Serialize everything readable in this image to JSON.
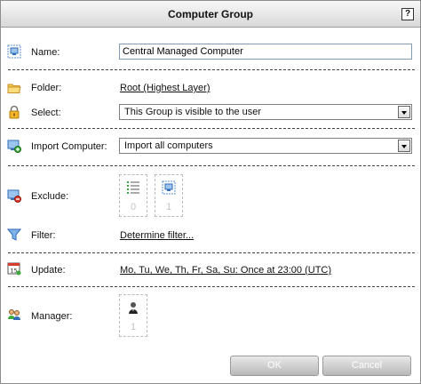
{
  "dialog": {
    "title": "Computer Group",
    "help": "?"
  },
  "fields": {
    "name": {
      "label": "Name:",
      "value": "Central Managed Computer"
    },
    "folder": {
      "label": "Folder:",
      "link": "Root (Highest Layer)"
    },
    "select": {
      "label": "Select:",
      "value": "This Group is visible to the user"
    },
    "import": {
      "label": "Import Computer:",
      "value": "Import all computers"
    },
    "exclude": {
      "label": "Exclude:",
      "tiles": [
        {
          "icon": "list-icon",
          "count": "0"
        },
        {
          "icon": "computer-icon",
          "count": "1"
        }
      ]
    },
    "filter": {
      "label": "Filter:",
      "link": "Determine filter..."
    },
    "update": {
      "label": "Update:",
      "link": "Mo, Tu, We, Th, Fr, Sa, Su: Once at 23:00 (UTC)"
    },
    "manager": {
      "label": "Manager:",
      "tiles": [
        {
          "icon": "user-icon",
          "count": "1"
        }
      ]
    }
  },
  "buttons": {
    "ok": "OK",
    "cancel": "Cancel"
  },
  "icons": {
    "name": "computer-group-icon",
    "folder": "folder-icon",
    "select": "lock-icon",
    "import": "import-computer-icon",
    "exclude": "exclude-computer-icon",
    "filter": "filter-icon",
    "update": "calendar-icon",
    "manager": "managers-icon"
  }
}
